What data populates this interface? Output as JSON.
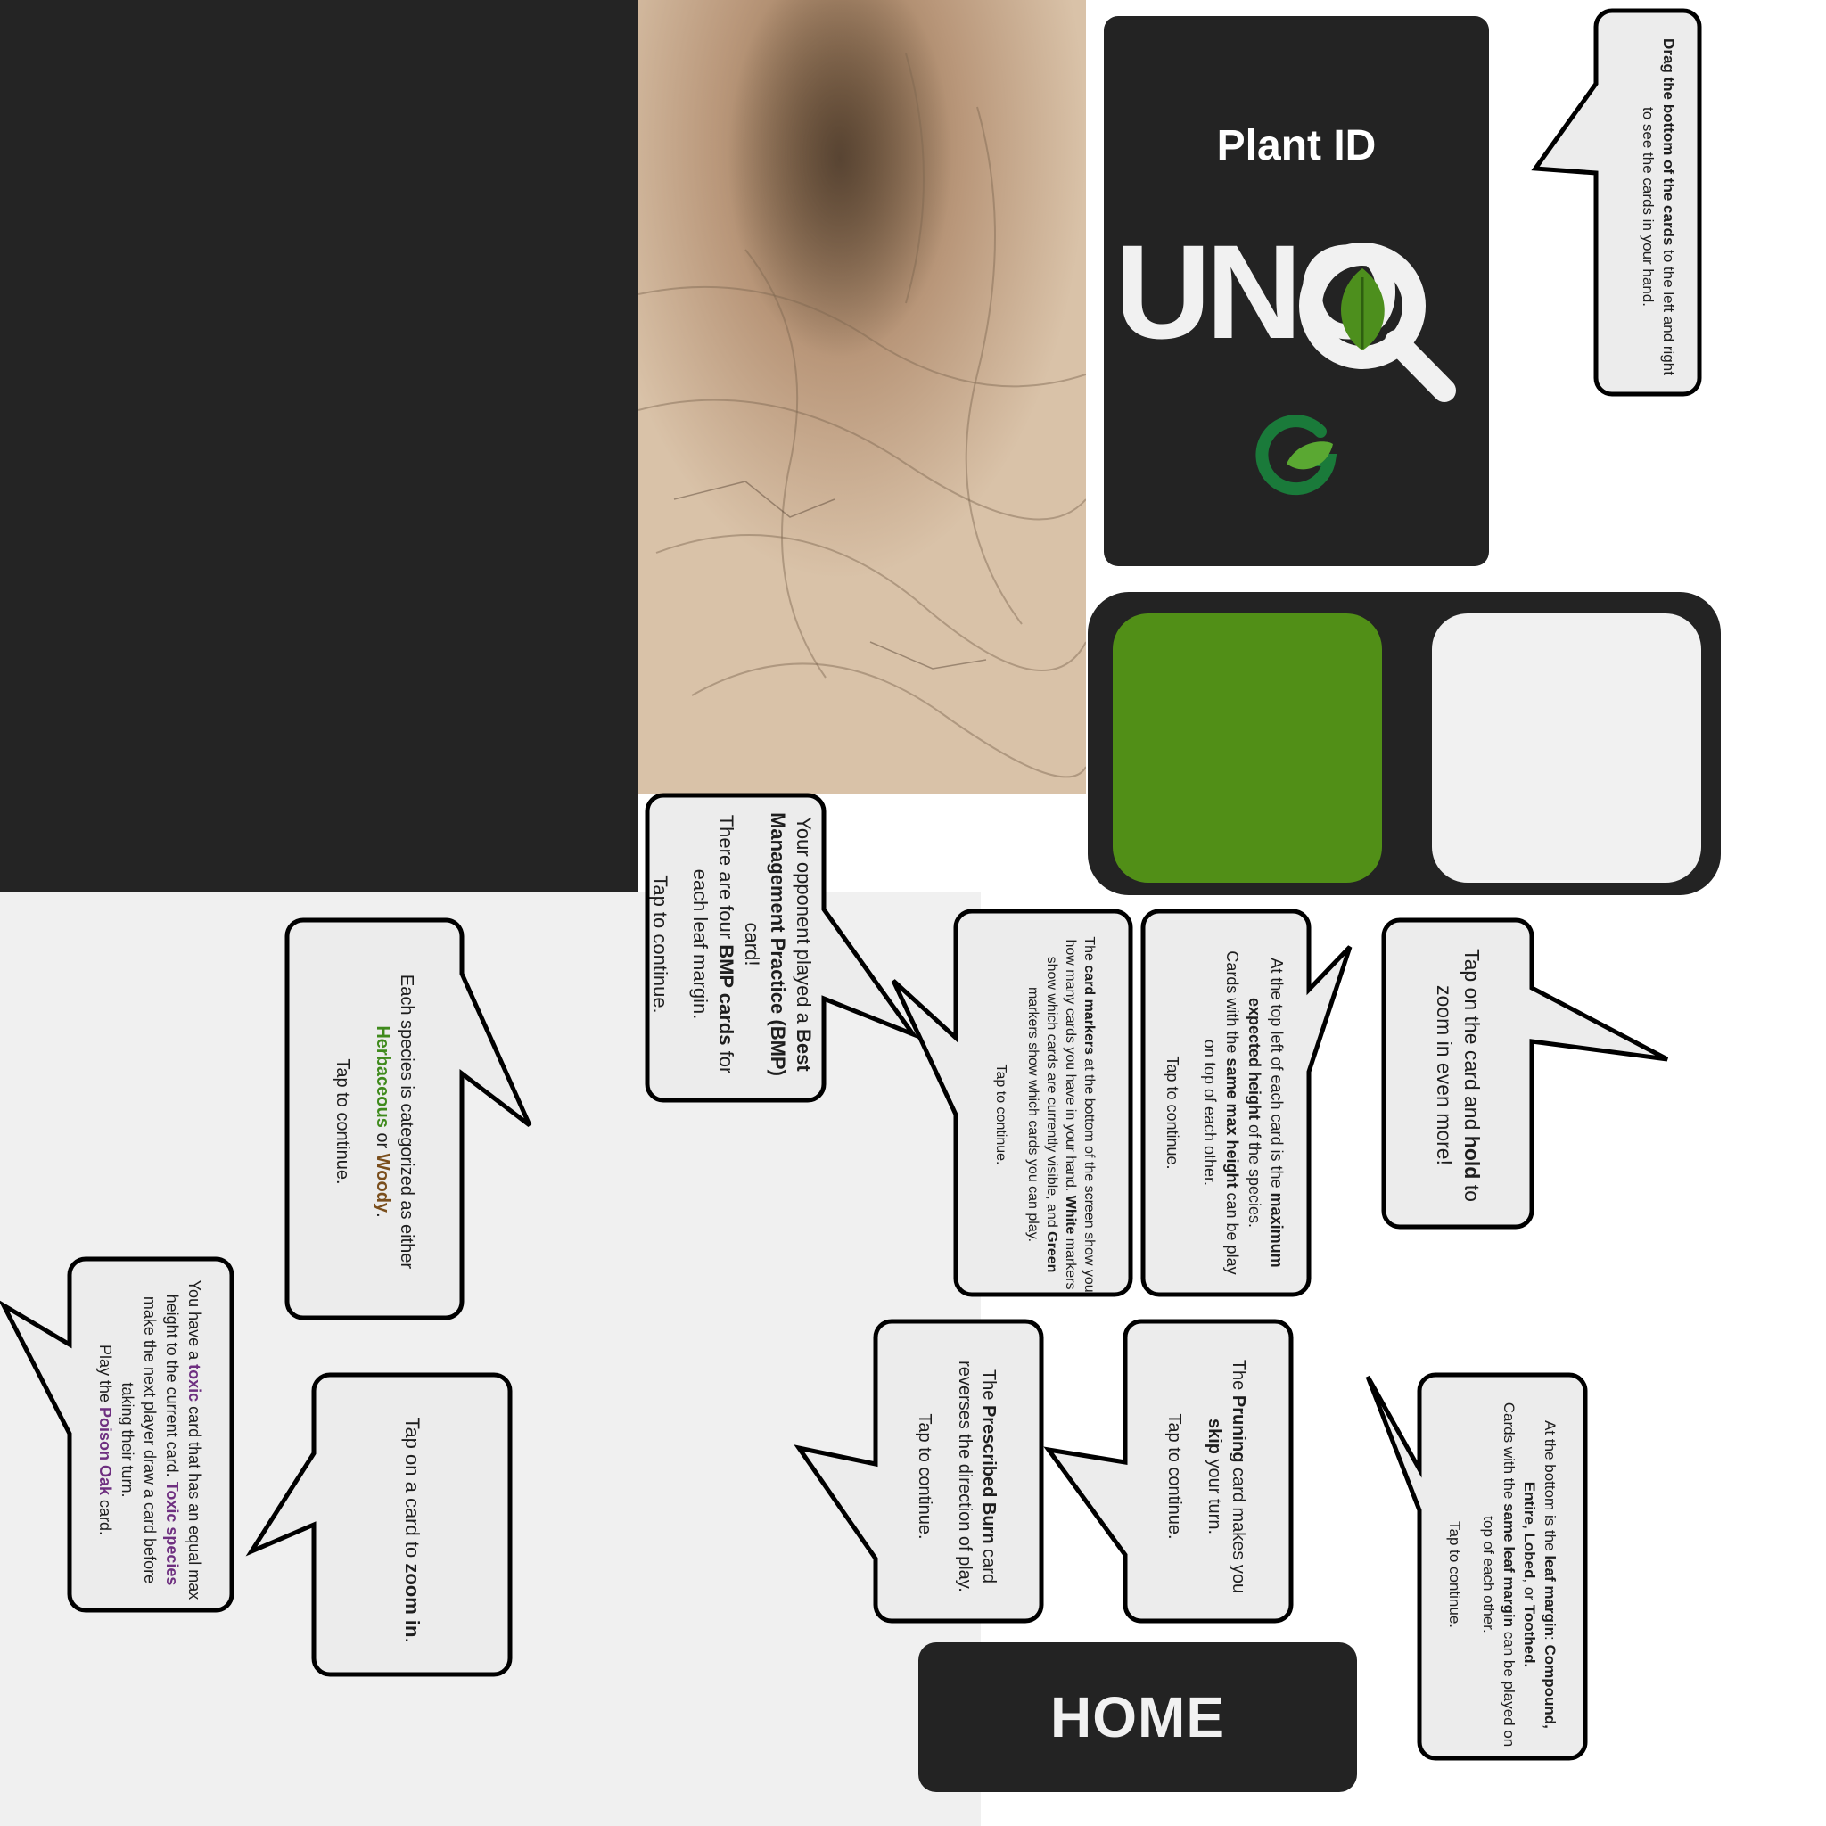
{
  "card_back": {
    "title": "Plant ID",
    "logo_text": "UNO",
    "colors": {
      "background": "#232323",
      "text": "#ffffff",
      "leaf": "#4d8f1d",
      "logo_g": "#1a7a3a"
    }
  },
  "swatches": {
    "left_color": "#518f17",
    "right_color": "#f1f1f1"
  },
  "home_button": {
    "label": "HOME"
  },
  "bubbles": {
    "drag": {
      "b1": "Drag the bottom of the cards",
      "t1": " to the left and right to see the cards in your hand."
    },
    "bmp": {
      "t1": "Your opponent played a ",
      "b1": "Best Management Practice (BMP)",
      "t2": " card!",
      "t3": "There are four ",
      "b2": "BMP cards",
      "t4": " for each leaf margin.",
      "tap": "Tap to continue."
    },
    "species": {
      "t1": "Each species is categorized as either ",
      "b1": "Herbaceous",
      "t2": " or ",
      "b2": "Woody",
      "t3": ".",
      "tap": "Tap to continue."
    },
    "markers": {
      "t1": "The ",
      "b1": "card markers",
      "t2": " at the bottom of the screen show you how many cards you have in your hand. ",
      "b2": "White",
      "t3": " markers show which cards are currently visible, and ",
      "b3": "Green",
      "t4": " markers show which cards you can play.",
      "tap": "Tap to continue."
    },
    "height": {
      "t1": "At the top left of each card is the ",
      "b1": "maximum expected height",
      "t2": " of the species.",
      "t3": "Cards with the ",
      "b2": "same max height",
      "t4": " can be play on top of each other.",
      "tap": "Tap to continue."
    },
    "hold": {
      "t1": "Tap on the card and ",
      "b1": "hold",
      "t2": " to zoom in even more!"
    },
    "toxic": {
      "t1": "You have a ",
      "b1": "toxic",
      "t2": " card that has an equal max height to the current card. ",
      "b2": "Toxic species",
      "t3": " make the next player draw a card before taking their turn.",
      "t4": "Play the ",
      "b3": "Poison Oak",
      "t5": " card."
    },
    "zoom": {
      "t1": "Tap on a card to ",
      "b1": "zoom in",
      "t2": "."
    },
    "burn": {
      "t1": "The ",
      "b1": "Prescribed Burn",
      "t2": " card reverses the direction of play.",
      "tap": "Tap to continue."
    },
    "pruning": {
      "t1": "The ",
      "b1": "Pruning",
      "t2": " card makes you ",
      "b2": "skip",
      "t3": " your turn.",
      "tap": "Tap to continue."
    },
    "margin": {
      "t1": "At the bottom is the ",
      "b1": "leaf margin",
      "t2": ": ",
      "b2": "Compound, Entire, Lobed",
      "t3": ", or ",
      "b3": "Toothed.",
      "t4": "Cards with the ",
      "b4": "same leaf margin",
      "t5": " can be played on top of each other.",
      "tap": "Tap to continue."
    }
  }
}
